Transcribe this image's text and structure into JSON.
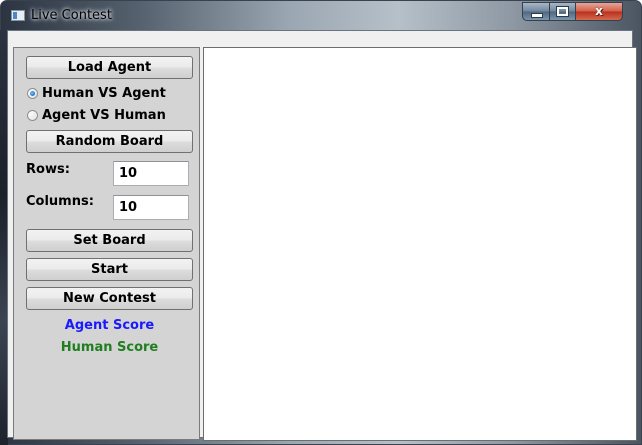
{
  "window": {
    "title": "Live Contest",
    "controls": {
      "minimize": "minimize-icon",
      "maximize": "maximize-icon",
      "close": "close-icon",
      "close_glyph": "x"
    }
  },
  "panel": {
    "load_agent": "Load Agent",
    "mode_options": [
      {
        "label": "Human VS Agent",
        "checked": true
      },
      {
        "label": "Agent VS Human",
        "checked": false
      }
    ],
    "random_board": "Random Board",
    "rows_label": "Rows:",
    "rows_value": "10",
    "columns_label": "Columns:",
    "columns_value": "10",
    "set_board": "Set Board",
    "start": "Start",
    "new_contest": "New Contest",
    "agent_score": "Agent Score",
    "human_score": "Human Score"
  },
  "colors": {
    "agent_score": "#1a1aff",
    "human_score": "#1f7f1f",
    "panel_bg": "#d4d4d4",
    "board_bg": "#ffffff"
  }
}
